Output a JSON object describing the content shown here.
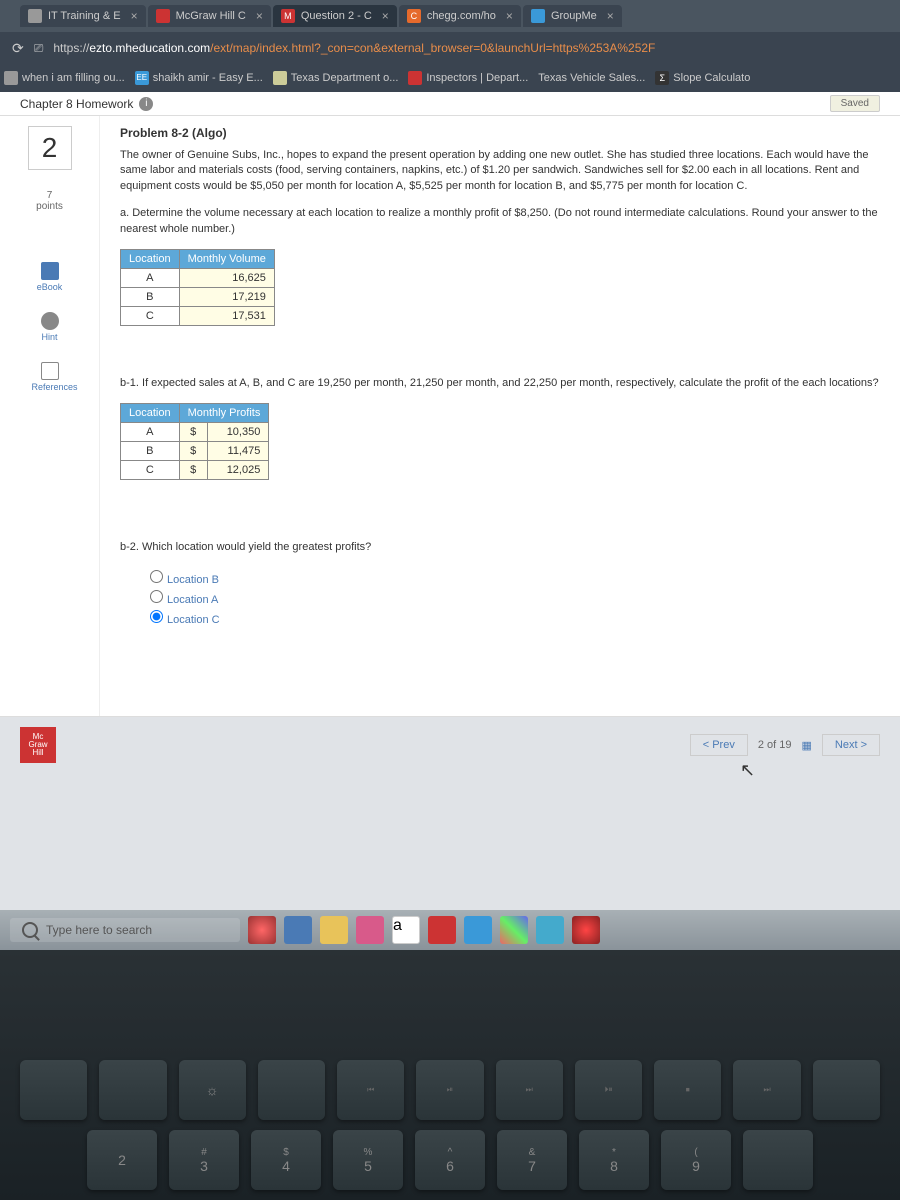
{
  "tabs": [
    {
      "label": "IT Training & E",
      "fav": "#999"
    },
    {
      "label": "McGraw Hill C",
      "fav": "#c33"
    },
    {
      "label": "Question 2 - C",
      "fav": "#c33",
      "prefix": "M",
      "active": true
    },
    {
      "label": "chegg.com/ho",
      "fav": "#e66a2c",
      "prefix": "C"
    },
    {
      "label": "GroupMe",
      "fav": "#3a99d8"
    }
  ],
  "url": {
    "scheme": "https://",
    "domain": "ezto.mheducation.com",
    "path": "/ext/map/index.html?_con=con&external_browser=0&launchUrl=https%253A%252F"
  },
  "bookmarks": [
    {
      "label": "when i am filling ou...",
      "color": "#999"
    },
    {
      "label": "shaikh amir - Easy E...",
      "color": "#3a99d8",
      "prefix": "EE"
    },
    {
      "label": "Texas Department o...",
      "color": "#cc9"
    },
    {
      "label": "Inspectors | Depart...",
      "color": "#c33"
    },
    {
      "label": "Texas Vehicle Sales...",
      "color": "#999"
    },
    {
      "label": "Slope Calculato",
      "color": "#333",
      "prefix": "Σ"
    }
  ],
  "header": {
    "title": "Chapter 8 Homework",
    "saved": "Saved"
  },
  "question": {
    "number": "2",
    "points_num": "7",
    "points_label": "points",
    "title": "Problem 8-2 (Algo)",
    "body": "The owner of Genuine Subs, Inc., hopes to expand the present operation by adding one new outlet. She has studied three locations. Each would have the same labor and materials costs (food, serving containers, napkins, etc.) of $1.20 per sandwich. Sandwiches sell for $2.00 each in all locations. Rent and equipment costs would be $5,050 per month for location A, $5,525 per month for location B, and $5,775 per month for location C.",
    "part_a": "a. Determine the volume necessary at each location to realize a monthly profit of $8,250. (Do not round intermediate calculations. Round your answer to the nearest whole number.)",
    "table_a": {
      "headers": [
        "Location",
        "Monthly Volume"
      ],
      "rows": [
        {
          "loc": "A",
          "val": "16,625"
        },
        {
          "loc": "B",
          "val": "17,219"
        },
        {
          "loc": "C",
          "val": "17,531"
        }
      ]
    },
    "part_b1": "b-1. If expected sales at A, B, and C are 19,250 per month, 21,250 per month, and 22,250 per month, respectively, calculate the profit of the each locations?",
    "table_b": {
      "headers": [
        "Location",
        "Monthly Profits"
      ],
      "currency": "$",
      "rows": [
        {
          "loc": "A",
          "val": "10,350"
        },
        {
          "loc": "B",
          "val": "11,475"
        },
        {
          "loc": "C",
          "val": "12,025"
        }
      ]
    },
    "part_b2": "b-2. Which location would yield the greatest profits?",
    "options": [
      "Location B",
      "Location A",
      "Location C"
    ],
    "selected": 2
  },
  "side": {
    "ebook": "eBook",
    "hint": "Hint",
    "references": "References"
  },
  "footer": {
    "logo": [
      "Mc",
      "Graw",
      "Hill"
    ],
    "prev": "< Prev",
    "count": "2 of 19",
    "next": "Next >"
  },
  "taskbar": {
    "search": "Type here to search"
  },
  "keyboard": {
    "fnrow": [
      "",
      "",
      "",
      "",
      "",
      "",
      "",
      "",
      "",
      "",
      ""
    ],
    "fnsubs": [
      "",
      "",
      "☼",
      "",
      "⏮",
      "⏯",
      "⏭",
      "⏵⏸",
      "⏹",
      "⏭",
      ""
    ],
    "numrow_top": [
      "",
      "#",
      "$",
      "%",
      "^",
      "&",
      "*",
      "(",
      ""
    ],
    "numrow": [
      "2",
      "3",
      "4",
      "5",
      "6",
      "7",
      "8",
      "9",
      ""
    ]
  }
}
